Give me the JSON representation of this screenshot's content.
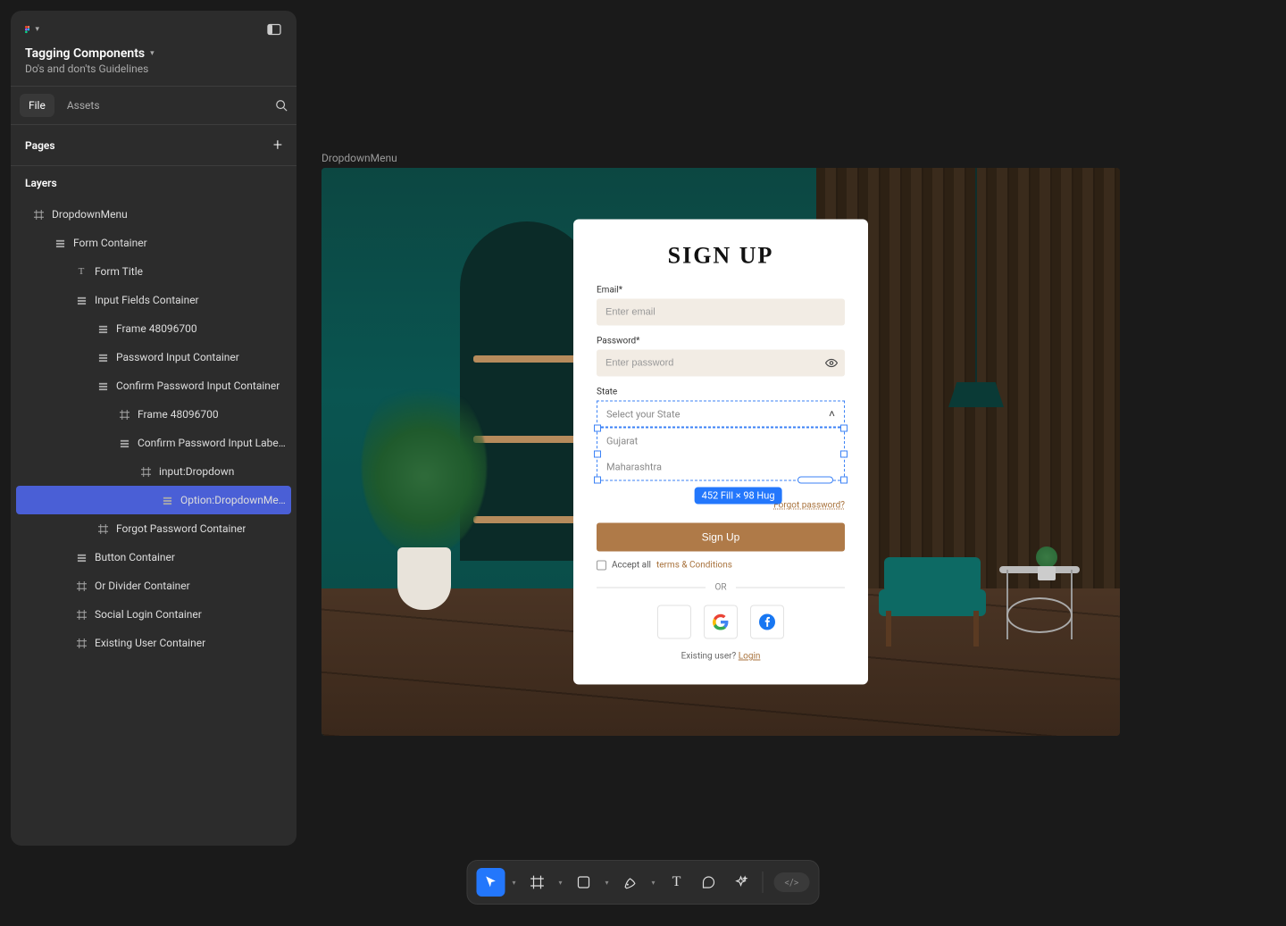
{
  "project": {
    "title": "Tagging Components",
    "subtitle": "Do's and don'ts Guidelines"
  },
  "tabs": {
    "file": "File",
    "assets": "Assets"
  },
  "panels": {
    "pages": "Pages",
    "layers": "Layers"
  },
  "layers": [
    {
      "label": "DropdownMenu",
      "icon": "frame",
      "indent": 0
    },
    {
      "label": "Form Container",
      "icon": "autolayout",
      "indent": 1
    },
    {
      "label": "Form Title",
      "icon": "text",
      "indent": 2
    },
    {
      "label": "Input Fields Container",
      "icon": "autolayout",
      "indent": 2
    },
    {
      "label": "Frame 48096700",
      "icon": "autolayout",
      "indent": 3
    },
    {
      "label": "Password Input Container",
      "icon": "autolayout",
      "indent": 3
    },
    {
      "label": "Confirm Password Input Container",
      "icon": "autolayout",
      "indent": 3
    },
    {
      "label": "Frame 48096700",
      "icon": "frame",
      "indent": 4
    },
    {
      "label": "Confirm Password Input Labe...",
      "icon": "autolayout",
      "indent": 4
    },
    {
      "label": "input:Dropdown",
      "icon": "frame",
      "indent": 5
    },
    {
      "label": "Option:DropdownMenu",
      "icon": "autolayout",
      "indent": 6,
      "selected": true
    },
    {
      "label": "Forgot Password Container",
      "icon": "frame",
      "indent": 3
    },
    {
      "label": "Button Container",
      "icon": "autolayout",
      "indent": 2
    },
    {
      "label": "Or Divider Container",
      "icon": "frame",
      "indent": 2
    },
    {
      "label": "Social Login Container",
      "icon": "frame",
      "indent": 2
    },
    {
      "label": "Existing User Container",
      "icon": "frame",
      "indent": 2
    }
  ],
  "canvas": {
    "frame_label": "DropdownMenu",
    "selection_badge": "452 Fill × 98 Hug"
  },
  "form": {
    "title": "SIGN UP",
    "email_label": "Email*",
    "email_placeholder": "Enter email",
    "password_label": "Password*",
    "password_placeholder": "Enter password",
    "state_label": "State",
    "state_placeholder": "Select your State",
    "state_options": [
      "Gujarat",
      "Maharashtra"
    ],
    "forgot": "Forgot password?",
    "signup_btn": "Sign Up",
    "accept_prefix": "Accept all ",
    "accept_link": "terms & Conditions",
    "or": "OR",
    "existing_prefix": "Existing user? ",
    "existing_link": "Login"
  }
}
